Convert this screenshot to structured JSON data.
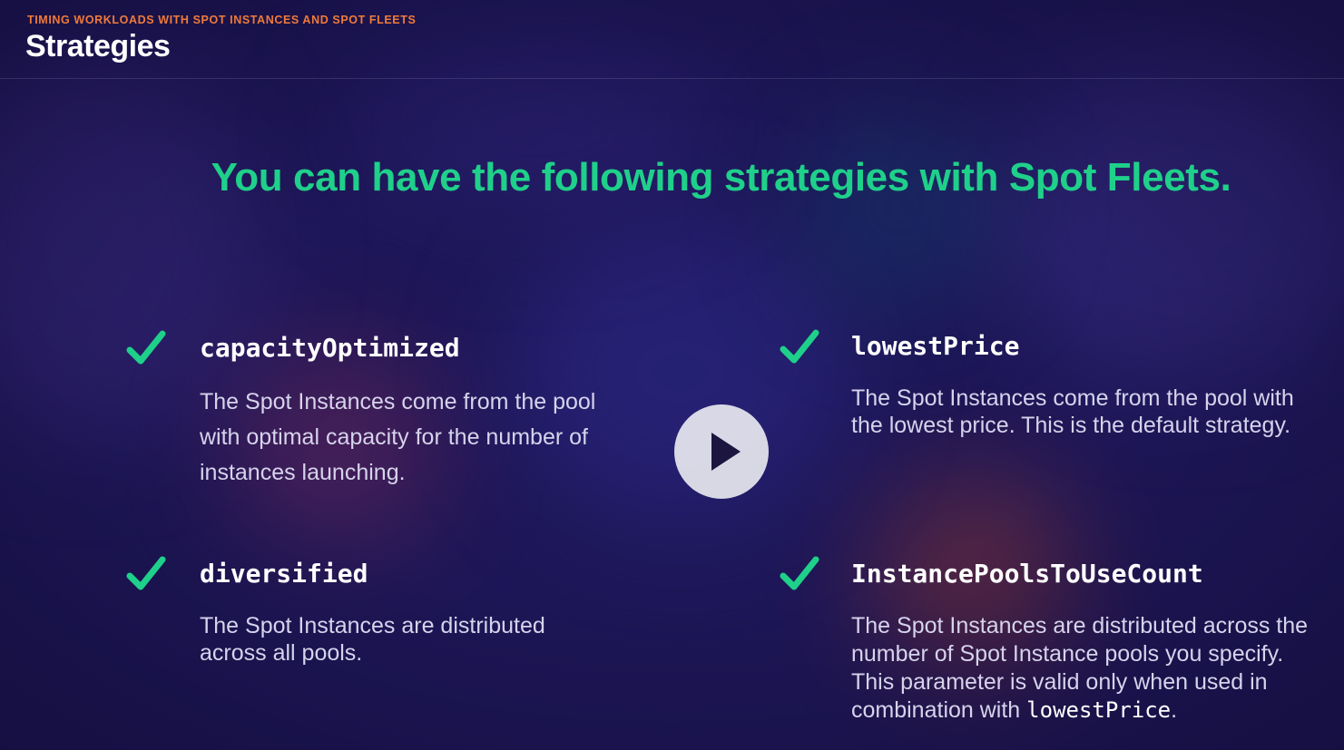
{
  "header": {
    "eyebrow": "TIMING WORKLOADS WITH SPOT INSTANCES AND SPOT FLEETS",
    "title": "Strategies"
  },
  "headline": "You can have the following strategies with Spot Fleets.",
  "strategies": [
    {
      "name": "capacityOptimized",
      "description": "The Spot Instances come from the pool with optimal capacity for the number of instances launching."
    },
    {
      "name": "lowestPrice",
      "description": "The Spot Instances come from the pool with the lowest price. This is the default strategy."
    },
    {
      "name": "diversified",
      "description": "The Spot Instances are distributed across all pools."
    },
    {
      "name": "InstancePoolsToUseCount",
      "description": "The Spot Instances are distributed across the number of Spot Instance pools you specify. This parameter is valid only when used in combination with",
      "description_code": "lowestPrice",
      "description_end": "."
    }
  ],
  "icons": {
    "check": "checkmark-icon",
    "play": "play-icon"
  },
  "colors": {
    "accent_green": "#1fd08a",
    "eyebrow_orange": "#f07a3a",
    "background": "#1d1656"
  }
}
